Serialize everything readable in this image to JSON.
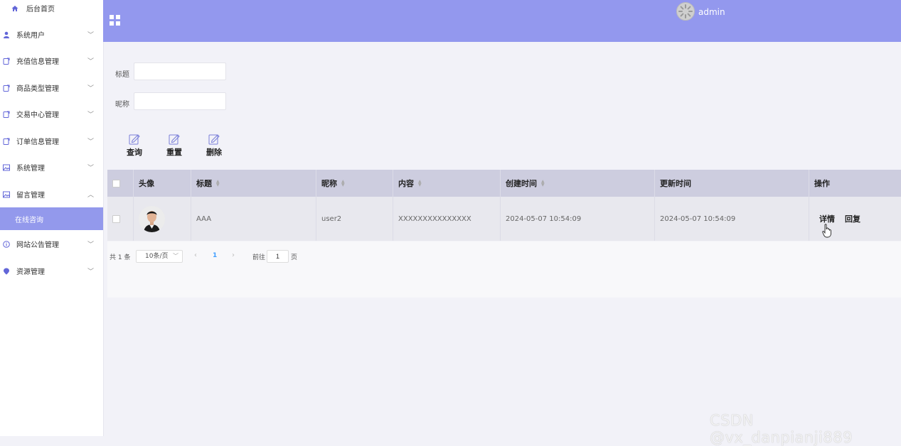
{
  "sidebar": {
    "home": "后台首页",
    "items": [
      {
        "label": "系统用户",
        "icon": "user-icon"
      },
      {
        "label": "充值信息管理",
        "icon": "document-icon"
      },
      {
        "label": "商品类型管理",
        "icon": "document-icon"
      },
      {
        "label": "交易中心管理",
        "icon": "document-icon"
      },
      {
        "label": "订单信息管理",
        "icon": "document-icon"
      },
      {
        "label": "系统管理",
        "icon": "image-icon"
      },
      {
        "label": "留言管理",
        "icon": "image-icon"
      },
      {
        "label": "网站公告管理",
        "icon": "info-circle-icon"
      },
      {
        "label": "资源管理",
        "icon": "location-icon"
      }
    ],
    "sub_item": "在线咨询"
  },
  "header": {
    "username": "admin"
  },
  "search": {
    "title_label": "标题",
    "title_value": "",
    "nickname_label": "昵称",
    "nickname_value": ""
  },
  "toolbar": {
    "query": "查询",
    "reset": "重置",
    "delete": "删除"
  },
  "table": {
    "columns": [
      "头像",
      "标题",
      "昵称",
      "内容",
      "创建时间",
      "更新时间",
      "操作"
    ],
    "rows": [
      {
        "title": "AAA",
        "nickname": "user2",
        "content": "XXXXXXXXXXXXXXX",
        "created": "2024-05-07 10:54:09",
        "updated": "2024-05-07 10:54:09",
        "actions": [
          "详情",
          "回复"
        ]
      }
    ]
  },
  "pagination": {
    "total": "共 1 条",
    "page_size": "10条/页",
    "current_page": "1",
    "goto_label": "前往",
    "goto_value": "1",
    "page_suffix": "页"
  },
  "watermark": "CSDN @vx_danpianji889",
  "colors": {
    "accent": "#9398ee",
    "active_menu": "#9399ec",
    "table_header": "#cdcddf"
  }
}
